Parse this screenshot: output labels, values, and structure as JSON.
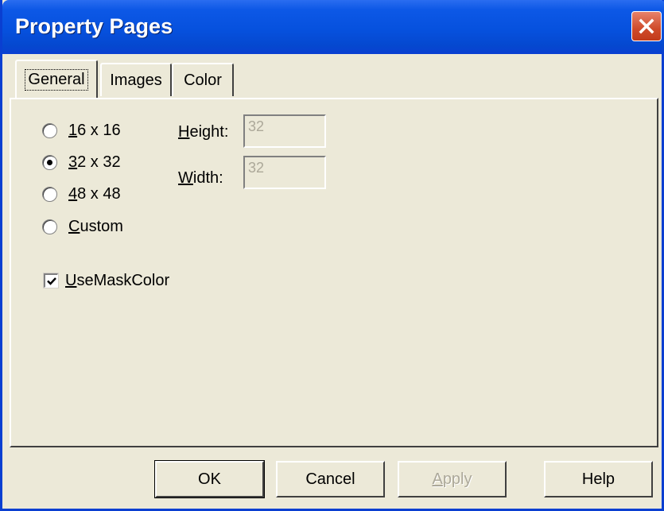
{
  "window": {
    "title": "Property Pages",
    "close_icon": "close-icon"
  },
  "tabs": [
    {
      "label": "General",
      "active": true
    },
    {
      "label": "Images",
      "active": false
    },
    {
      "label": "Color",
      "active": false
    }
  ],
  "general": {
    "size_options": [
      {
        "mnemonic": "1",
        "rest": "6 x 16",
        "checked": false
      },
      {
        "mnemonic": "3",
        "rest": "2 x 32",
        "checked": true
      },
      {
        "mnemonic": "4",
        "rest": "8 x 48",
        "checked": false
      },
      {
        "mnemonic": "C",
        "rest": "ustom",
        "checked": false
      }
    ],
    "height": {
      "mnemonic": "H",
      "rest": "eight:",
      "value": "32",
      "enabled": false
    },
    "width": {
      "mnemonic": "W",
      "rest": "idth:",
      "value": "32",
      "enabled": false
    },
    "use_mask_color": {
      "mnemonic": "U",
      "rest": "seMaskColor",
      "checked": true
    }
  },
  "buttons": {
    "ok": "OK",
    "cancel": "Cancel",
    "apply_mnemonic": "A",
    "apply_rest": "pply",
    "help": "Help"
  },
  "colors": {
    "titlebar": "#0651de",
    "dialog_bg": "#ece9d8",
    "close_button": "#cf4a2a",
    "disabled_text": "#aca899"
  }
}
